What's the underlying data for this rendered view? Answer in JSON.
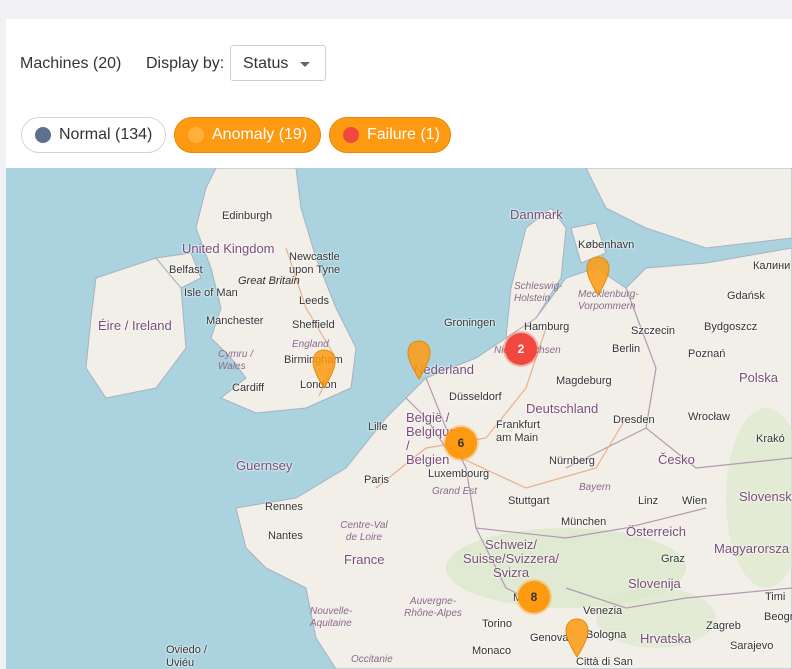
{
  "toolbar": {
    "machines_label": "Machines (20)",
    "display_by_label": "Display by:",
    "display_select": {
      "value": "Status"
    }
  },
  "filters": [
    {
      "label": "Normal (134)",
      "dot_color": "#5e6f8f"
    },
    {
      "label": "Anomaly (19)",
      "dot_color": "#ffb13b",
      "bg": "#fd9a12"
    },
    {
      "label": "Failure (1)",
      "dot_color": "#f0483e",
      "bg": "#fd9a12"
    }
  ],
  "map": {
    "clusters": [
      {
        "count": "2",
        "status": "failure",
        "color": "#f0483e"
      },
      {
        "count": "6",
        "status": "anomaly",
        "color": "#fd9a12"
      },
      {
        "count": "8",
        "status": "anomaly",
        "color": "#fd9a12"
      }
    ],
    "countries": {
      "uk": "United Kingdom",
      "ireland": "Éire / Ireland",
      "danmark": "Danmark",
      "nederland": "Nederland",
      "belgie": "België / Belgique / Belgien",
      "deutschland": "Deutschland",
      "france": "France",
      "schweiz": "Schweiz/ Suisse/Svizzera/ Svizra",
      "osterreich": "Österreich",
      "cesko": "Česko",
      "polska": "Polska",
      "slovensko": "Slovensko",
      "slovenija": "Slovenija",
      "hrvatska": "Hrvatska",
      "magyarorszag": "Magyarorsza",
      "guernsey": "Guernsey"
    },
    "cities": {
      "edinburgh": "Edinburgh",
      "newcastle": "Newcastle upon Tyne",
      "belfast": "Belfast",
      "isle_of_man": "Isle of Man",
      "leeds": "Leeds",
      "manchester": "Manchester",
      "sheffield": "Sheffield",
      "birmingham": "Birmingham",
      "cardiff": "Cardiff",
      "london": "London",
      "lille": "Lille",
      "paris": "Paris",
      "rennes": "Rennes",
      "nantes": "Nantes",
      "luxembourg": "Luxembourg",
      "groningen": "Groningen",
      "hamburg": "Hamburg",
      "dusseldorf": "Düsseldorf",
      "frankfurt": "Frankfurt am Main",
      "nurnberg": "Nürnberg",
      "stuttgart": "Stuttgart",
      "munchen": "München",
      "magdeburg": "Magdeburg",
      "berlin": "Berlin",
      "dresden": "Dresden",
      "szczecin": "Szczecin",
      "bydgoszcz": "Bydgoszcz",
      "gdansk": "Gdańsk",
      "poznan": "Poznań",
      "wroclaw": "Wrocław",
      "krakow": "Krakó",
      "kobenhavn": "København",
      "kaliningrad": "Калини",
      "linz": "Linz",
      "wien": "Wien",
      "graz": "Graz",
      "torino": "Torino",
      "genova": "Genova",
      "venezia": "Venezia",
      "bologna": "Bologna",
      "monaco": "Monaco",
      "citta": "Città di San",
      "zagreb": "Zagreb",
      "sarajevo": "Sarajevo",
      "oviedo": "Oviedo / Uviéu",
      "mi": "Mi",
      "timisoara": "Timi",
      "beog": "Beogr"
    },
    "regions": {
      "england": "England",
      "great_britain": "Great Britain",
      "cymru": "Cymru / Wales",
      "schleswig": "Schleswig-Holstein",
      "mecklenburg": "Mecklenburg-Vorpommern",
      "niedersachsen": "Niedersachsen",
      "grand_est": "Grand Est",
      "bayern": "Bayern",
      "centre": "Centre-Val de Loire",
      "nouvelle": "Nouvelle-Aquitaine",
      "auvergne": "Auvergne-Rhône-Alpes",
      "occitanie": "Occitanie"
    }
  }
}
